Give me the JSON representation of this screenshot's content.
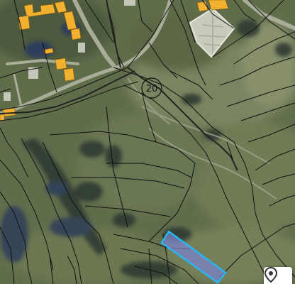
{
  "map": {
    "base_layer": "satellite-imagery",
    "overlay": "cadastral-parcel-boundaries",
    "boundary_color": "#111111",
    "highlight_parcel": {
      "fill": "#7b82c9",
      "stroke": "#29b6f6"
    },
    "building_color": "#f2b230",
    "parcel_label": "20"
  },
  "controls": {
    "locate_button": {
      "icon": "location-marker-icon"
    }
  }
}
